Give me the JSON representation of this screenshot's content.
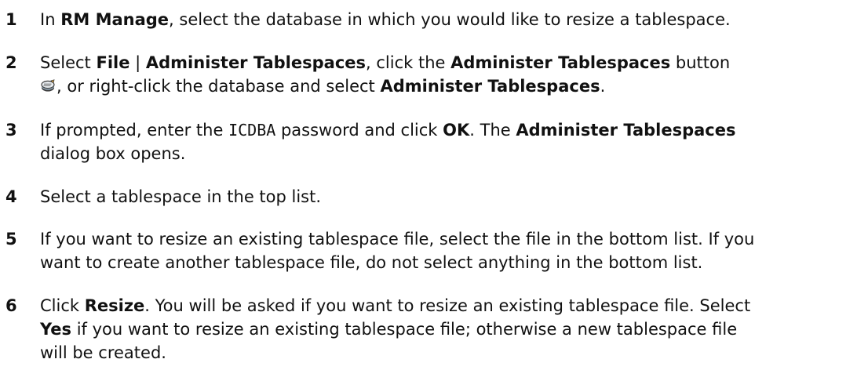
{
  "steps": [
    {
      "number": "1",
      "p1": "In ",
      "b1": "RM Manage",
      "p2": ", select the database in which you would like to resize a tablespace."
    },
    {
      "number": "2",
      "p1": "Select ",
      "b1": "File",
      "p2": " | ",
      "b2": "Administer Tablespaces",
      "p3": ", click the ",
      "b3": "Administer Tablespaces",
      "p4": " button",
      "icon": "administer-tablespaces-icon",
      "p5": ", or right-click the database and select ",
      "b4": "Administer Tablespaces",
      "p6": "."
    },
    {
      "number": "3",
      "p1": "If prompted, enter the ",
      "code": "ICDBA",
      "p2": " password and click ",
      "b1": "OK",
      "p3": ". The ",
      "b2": "Administer Tablespaces",
      "p4": "dialog box opens."
    },
    {
      "number": "4",
      "p1": "Select a tablespace in the top list."
    },
    {
      "number": "5",
      "line1": "If you want to resize an existing tablespace file, select the file in the bottom list. If you",
      "line2": "want to create another tablespace file, do not select anything in the bottom list."
    },
    {
      "number": "6",
      "p1": "Click ",
      "b1": "Resize",
      "p2": ". You will be asked if you want to resize an existing tablespace file. Select",
      "b2": "Yes",
      "p3": " if you want to resize an existing tablespace file; otherwise a new tablespace file",
      "p4": "will be created."
    }
  ]
}
